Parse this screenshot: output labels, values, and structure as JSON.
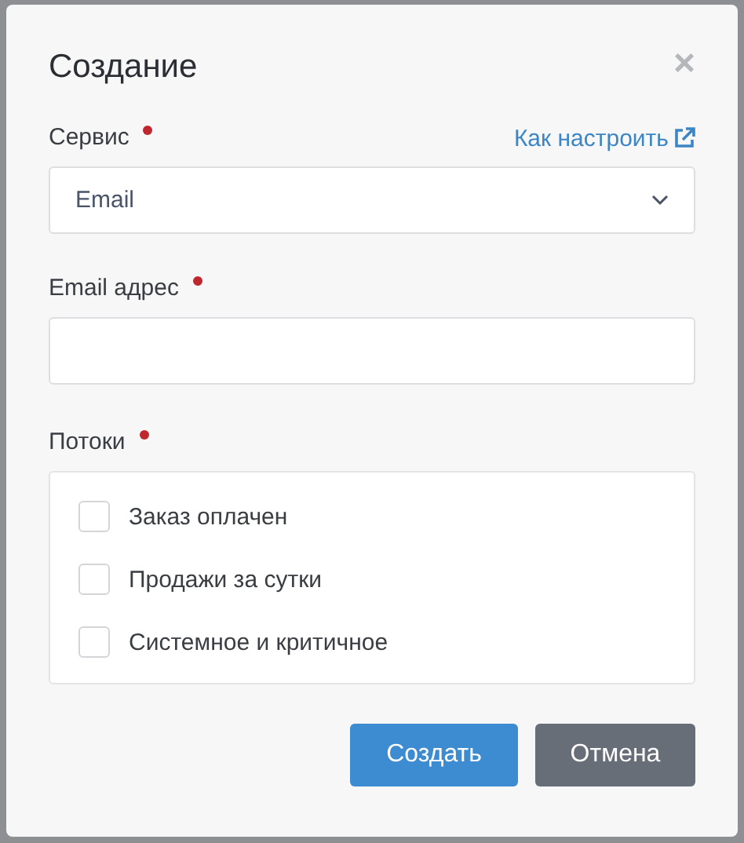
{
  "dialog": {
    "title": "Создание",
    "close": "×"
  },
  "fields": [
    {
      "kind": "select",
      "label": "Сервис",
      "required": true,
      "help_link": "Как настроить",
      "value": "Email"
    },
    {
      "kind": "input",
      "label": "Email адрес",
      "required": true
    },
    {
      "kind": "checklist",
      "label": "Потоки",
      "required": true,
      "options": [
        {
          "label": "Заказ оплачен",
          "checked": false
        },
        {
          "label": "Продажи за сутки",
          "checked": false
        },
        {
          "label": "Системное и критичное",
          "checked": false
        }
      ]
    }
  ],
  "buttons": [
    {
      "label": "Создать",
      "kind": "primary"
    },
    {
      "label": "Отмена",
      "kind": "secondary"
    }
  ]
}
